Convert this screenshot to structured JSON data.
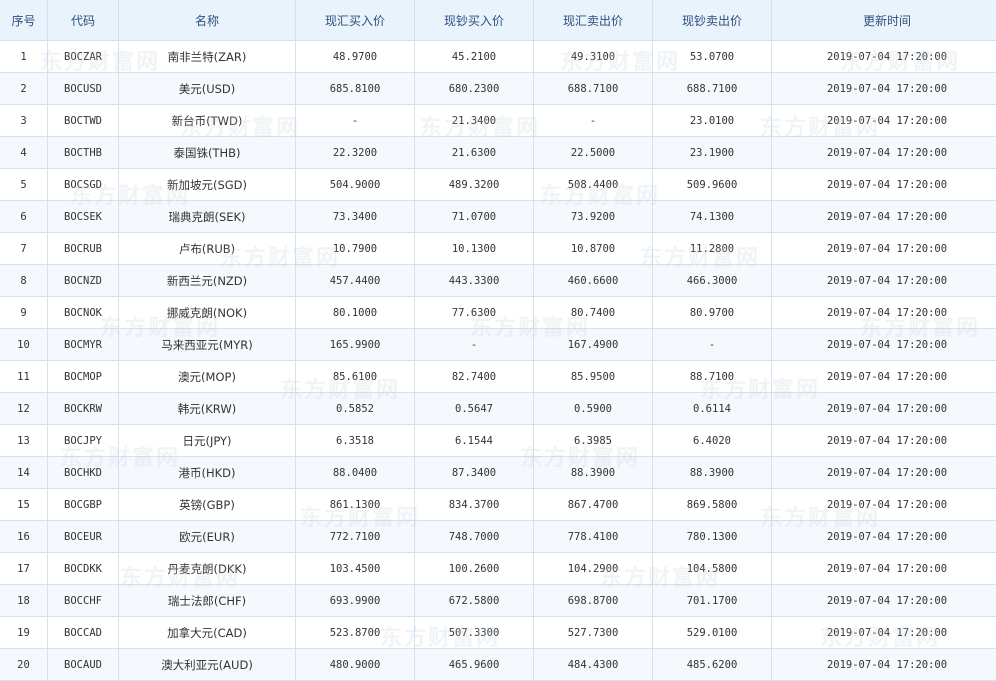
{
  "table": {
    "headers": [
      "序号",
      "代码",
      "名称",
      "现汇买入价",
      "现钞买入价",
      "现汇卖出价",
      "现钞卖出价",
      "更新时间"
    ],
    "rows": [
      [
        "1",
        "BOCZAR",
        "南非兰特(ZAR)",
        "48.9700",
        "45.2100",
        "49.3100",
        "53.0700",
        "2019-07-04 17:20:00"
      ],
      [
        "2",
        "BOCUSD",
        "美元(USD)",
        "685.8100",
        "680.2300",
        "688.7100",
        "688.7100",
        "2019-07-04 17:20:00"
      ],
      [
        "3",
        "BOCTWD",
        "新台币(TWD)",
        "-",
        "21.3400",
        "-",
        "23.0100",
        "2019-07-04 17:20:00"
      ],
      [
        "4",
        "BOCTHB",
        "泰国铢(THB)",
        "22.3200",
        "21.6300",
        "22.5000",
        "23.1900",
        "2019-07-04 17:20:00"
      ],
      [
        "5",
        "BOCSGD",
        "新加坡元(SGD)",
        "504.9000",
        "489.3200",
        "508.4400",
        "509.9600",
        "2019-07-04 17:20:00"
      ],
      [
        "6",
        "BOCSEK",
        "瑞典克朗(SEK)",
        "73.3400",
        "71.0700",
        "73.9200",
        "74.1300",
        "2019-07-04 17:20:00"
      ],
      [
        "7",
        "BOCRUB",
        "卢布(RUB)",
        "10.7900",
        "10.1300",
        "10.8700",
        "11.2800",
        "2019-07-04 17:20:00"
      ],
      [
        "8",
        "BOCNZD",
        "新西兰元(NZD)",
        "457.4400",
        "443.3300",
        "460.6600",
        "466.3000",
        "2019-07-04 17:20:00"
      ],
      [
        "9",
        "BOCNOK",
        "挪威克朗(NOK)",
        "80.1000",
        "77.6300",
        "80.7400",
        "80.9700",
        "2019-07-04 17:20:00"
      ],
      [
        "10",
        "BOCMYR",
        "马来西亚元(MYR)",
        "165.9900",
        "-",
        "167.4900",
        "-",
        "2019-07-04 17:20:00"
      ],
      [
        "11",
        "BOCMOP",
        "澳元(MOP)",
        "85.6100",
        "82.7400",
        "85.9500",
        "88.7100",
        "2019-07-04 17:20:00"
      ],
      [
        "12",
        "BOCKRW",
        "韩元(KRW)",
        "0.5852",
        "0.5647",
        "0.5900",
        "0.6114",
        "2019-07-04 17:20:00"
      ],
      [
        "13",
        "BOCJPY",
        "日元(JPY)",
        "6.3518",
        "6.1544",
        "6.3985",
        "6.4020",
        "2019-07-04 17:20:00"
      ],
      [
        "14",
        "BOCHKD",
        "港币(HKD)",
        "88.0400",
        "87.3400",
        "88.3900",
        "88.3900",
        "2019-07-04 17:20:00"
      ],
      [
        "15",
        "BOCGBP",
        "英镑(GBP)",
        "861.1300",
        "834.3700",
        "867.4700",
        "869.5800",
        "2019-07-04 17:20:00"
      ],
      [
        "16",
        "BOCEUR",
        "欧元(EUR)",
        "772.7100",
        "748.7000",
        "778.4100",
        "780.1300",
        "2019-07-04 17:20:00"
      ],
      [
        "17",
        "BOCDKK",
        "丹麦克朗(DKK)",
        "103.4500",
        "100.2600",
        "104.2900",
        "104.5800",
        "2019-07-04 17:20:00"
      ],
      [
        "18",
        "BOCCHF",
        "瑞士法郎(CHF)",
        "693.9900",
        "672.5800",
        "698.8700",
        "701.1700",
        "2019-07-04 17:20:00"
      ],
      [
        "19",
        "BOCCAD",
        "加拿大元(CAD)",
        "523.8700",
        "507.3300",
        "527.7300",
        "529.0100",
        "2019-07-04 17:20:00"
      ],
      [
        "20",
        "BOCAUD",
        "澳大利亚元(AUD)",
        "480.9000",
        "465.9600",
        "484.4300",
        "485.6200",
        "2019-07-04 17:20:00"
      ]
    ]
  },
  "watermark": {
    "text": "东方财富网"
  },
  "colors": {
    "header_bg": "#e9f3fc",
    "header_text": "#2f4f7f",
    "border": "#d4e2ef",
    "row_alt_bg": "#f5f9fd"
  }
}
